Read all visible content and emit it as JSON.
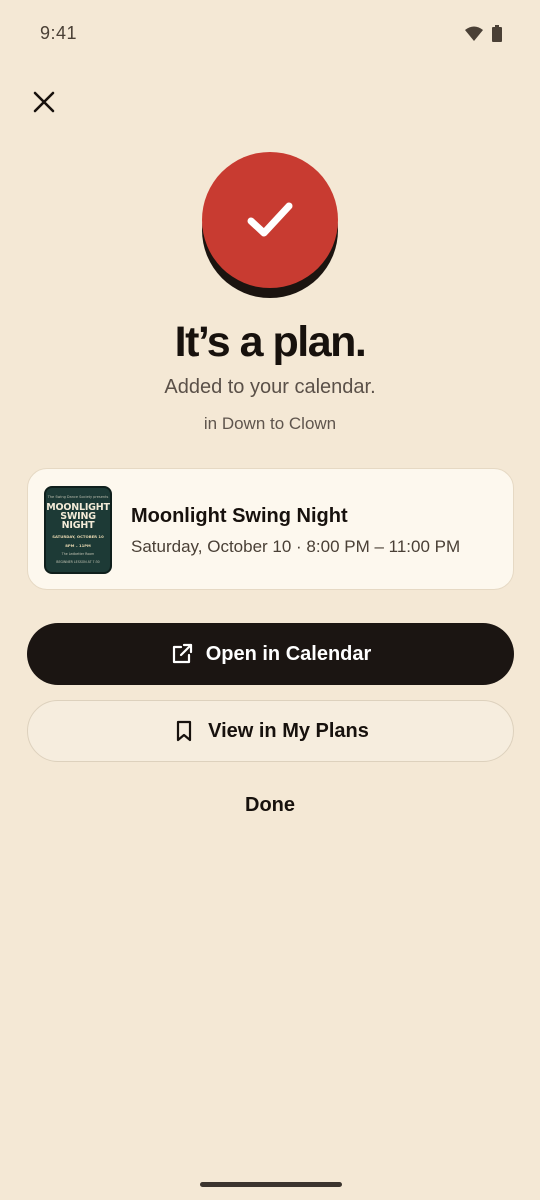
{
  "status_bar": {
    "time": "9:41"
  },
  "confirmation": {
    "headline": "It’s a plan.",
    "subhead": "Added to your calendar.",
    "group": "in Down to Clown"
  },
  "event": {
    "title": "Moonlight Swing Night",
    "datetime": "Saturday, October 10 · 8:00 PM – 11:00 PM",
    "poster": {
      "top_text": "The Swing Dance Society presents",
      "title": "MOONLIGHT SWING NIGHT",
      "date_line": "SATURDAY, OCTOBER 10",
      "time_line": "8PM – 11PM",
      "venue_line": "The Ledbetter Room",
      "note_line": "BEGINNER LESSON AT 7:30"
    }
  },
  "actions": {
    "open_calendar_label": "Open in Calendar",
    "view_plans_label": "View in My Plans",
    "done_label": "Done"
  },
  "colors": {
    "background": "#F4E8D5",
    "accent": "#C83B31",
    "primary_button": "#1B1512"
  }
}
